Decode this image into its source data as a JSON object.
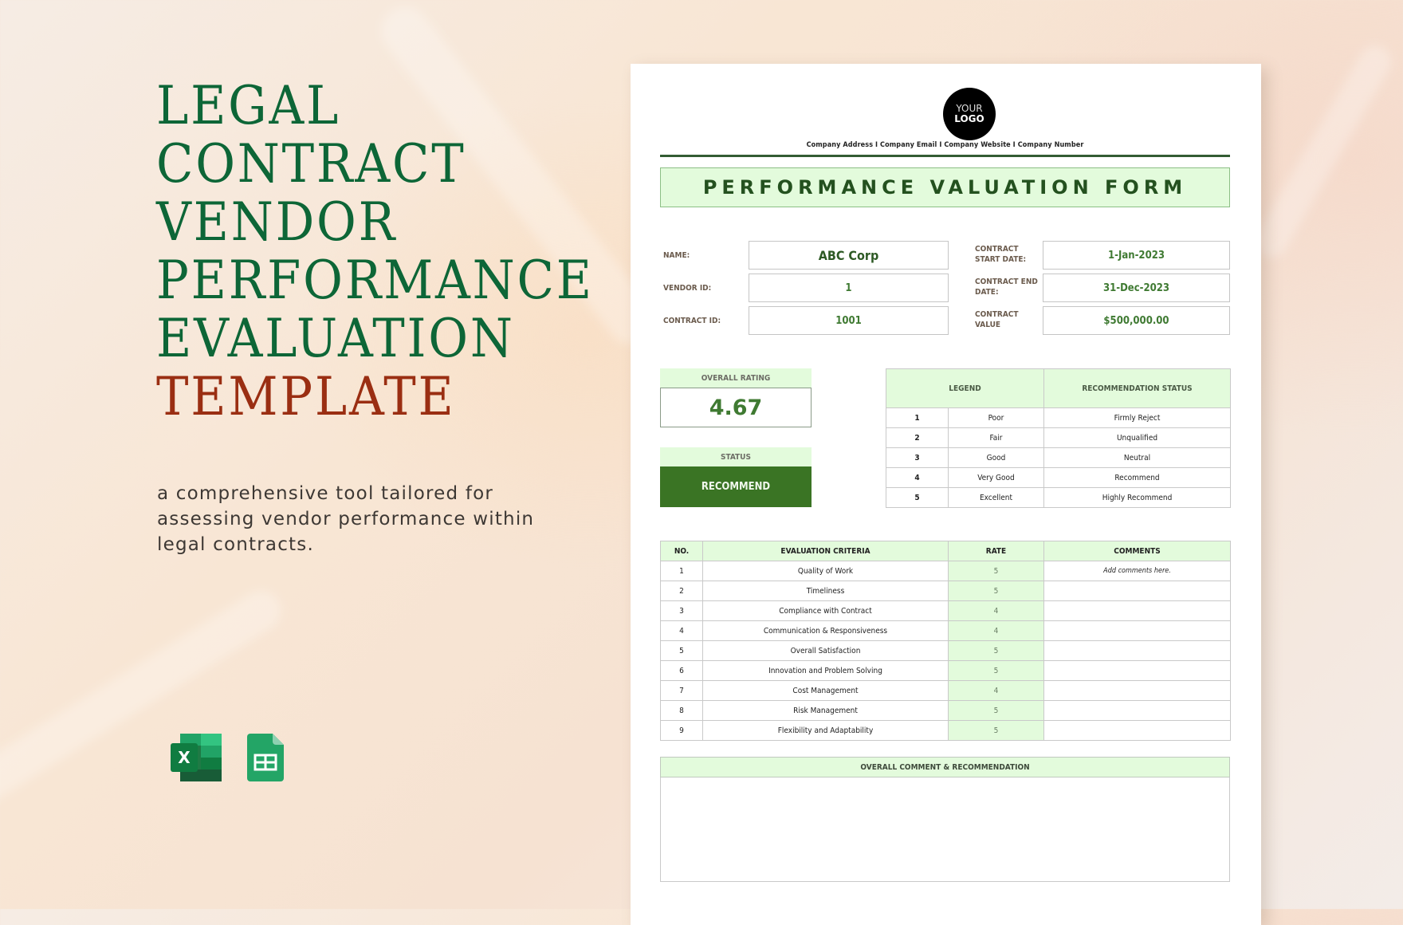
{
  "promo": {
    "title_lines": [
      "LEGAL",
      "CONTRACT",
      "VENDOR",
      "PERFORMANCE",
      "EVALUATION"
    ],
    "title_accent": "TEMPLATE",
    "subtitle": "a comprehensive tool tailored for assessing vendor performance within legal contracts.",
    "colors": {
      "title": "#0d6637",
      "accent": "#9a2e12"
    },
    "app_icons": [
      "excel-icon",
      "google-sheets-icon"
    ]
  },
  "document": {
    "logo": {
      "line1": "YOUR",
      "line2": "LOGO"
    },
    "company_line": "Company Address  I  Company Email  I  Company Website  I  Company Number",
    "form_title": "PERFORMANCE VALUATION FORM",
    "info": {
      "left": [
        {
          "label": "NAME:",
          "value": "ABC Corp"
        },
        {
          "label": "VENDOR ID:",
          "value": "1"
        },
        {
          "label": "CONTRACT ID:",
          "value": "1001"
        }
      ],
      "right": [
        {
          "label_1": "CONTRACT",
          "label_2": "START DATE:",
          "value": "1-Jan-2023"
        },
        {
          "label_1": "CONTRACT END",
          "label_2": "DATE:",
          "value": "31-Dec-2023"
        },
        {
          "label_1": "CONTRACT",
          "label_2": "VALUE",
          "value": "$500,000.00"
        }
      ]
    },
    "overall_rating": {
      "label": "OVERALL RATING",
      "value": "4.67"
    },
    "status": {
      "label": "STATUS",
      "value": "RECOMMEND"
    },
    "legend": {
      "headers": [
        "LEGEND",
        "RECOMMENDATION STATUS"
      ],
      "rows": [
        {
          "num": "1",
          "rating": "Poor",
          "status": "Firmly Reject"
        },
        {
          "num": "2",
          "rating": "Fair",
          "status": "Unqualified"
        },
        {
          "num": "3",
          "rating": "Good",
          "status": "Neutral"
        },
        {
          "num": "4",
          "rating": "Very Good",
          "status": "Recommend"
        },
        {
          "num": "5",
          "rating": "Excellent",
          "status": "Highly Recommend"
        }
      ]
    },
    "evaluation": {
      "headers": [
        "NO.",
        "EVALUATION CRITERIA",
        "RATE",
        "COMMENTS"
      ],
      "rows": [
        {
          "no": "1",
          "criteria": "Quality of Work",
          "rate": "5",
          "comment": "Add comments here."
        },
        {
          "no": "2",
          "criteria": "Timeliness",
          "rate": "5",
          "comment": ""
        },
        {
          "no": "3",
          "criteria": "Compliance with Contract",
          "rate": "4",
          "comment": ""
        },
        {
          "no": "4",
          "criteria": "Communication & Responsiveness",
          "rate": "4",
          "comment": ""
        },
        {
          "no": "5",
          "criteria": "Overall Satisfaction",
          "rate": "5",
          "comment": ""
        },
        {
          "no": "6",
          "criteria": "Innovation and Problem Solving",
          "rate": "5",
          "comment": ""
        },
        {
          "no": "7",
          "criteria": "Cost Management",
          "rate": "4",
          "comment": ""
        },
        {
          "no": "8",
          "criteria": "Risk Management",
          "rate": "5",
          "comment": ""
        },
        {
          "no": "9",
          "criteria": "Flexibility and Adaptability",
          "rate": "5",
          "comment": ""
        }
      ]
    },
    "overall_comment": {
      "label": "OVERALL COMMENT & RECOMMENDATION",
      "value": ""
    },
    "colors": {
      "header_fill": "#e3fbdc",
      "status_fill": "#3a7424",
      "value_text": "#3f7a32"
    }
  }
}
